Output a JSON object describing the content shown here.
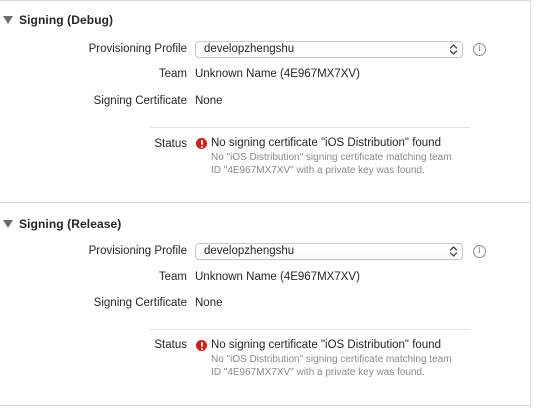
{
  "sections": [
    {
      "title": "Signing (Debug)",
      "provisioning_profile_label": "Provisioning Profile",
      "provisioning_profile_value": "developzhengshu",
      "team_label": "Team",
      "team_value": "Unknown Name (4E967MX7XV)",
      "signing_certificate_label": "Signing Certificate",
      "signing_certificate_value": "None",
      "status_label": "Status",
      "status_headline": "No signing certificate \"iOS Distribution\" found",
      "status_detail": "No \"iOS Distribution\" signing certificate matching team ID \"4E967MX7XV\" with a private key was found.",
      "info_icon": "i"
    },
    {
      "title": "Signing (Release)",
      "provisioning_profile_label": "Provisioning Profile",
      "provisioning_profile_value": "developzhengshu",
      "team_label": "Team",
      "team_value": "Unknown Name (4E967MX7XV)",
      "signing_certificate_label": "Signing Certificate",
      "signing_certificate_value": "None",
      "status_label": "Status",
      "status_headline": "No signing certificate \"iOS Distribution\" found",
      "status_detail": "No \"iOS Distribution\" signing certificate matching team ID \"4E967MX7XV\" with a private key was found.",
      "info_icon": "i"
    }
  ],
  "colors": {
    "error_red": "#d91d14",
    "secondary_text": "#8a8a8a",
    "primary_text": "#262626"
  },
  "icons": {
    "disclosure": "disclosure-triangle-down-icon",
    "popup_arrows": "popup-up-down-arrows-icon",
    "info": "info-circle-icon",
    "error": "error-circle-icon"
  }
}
